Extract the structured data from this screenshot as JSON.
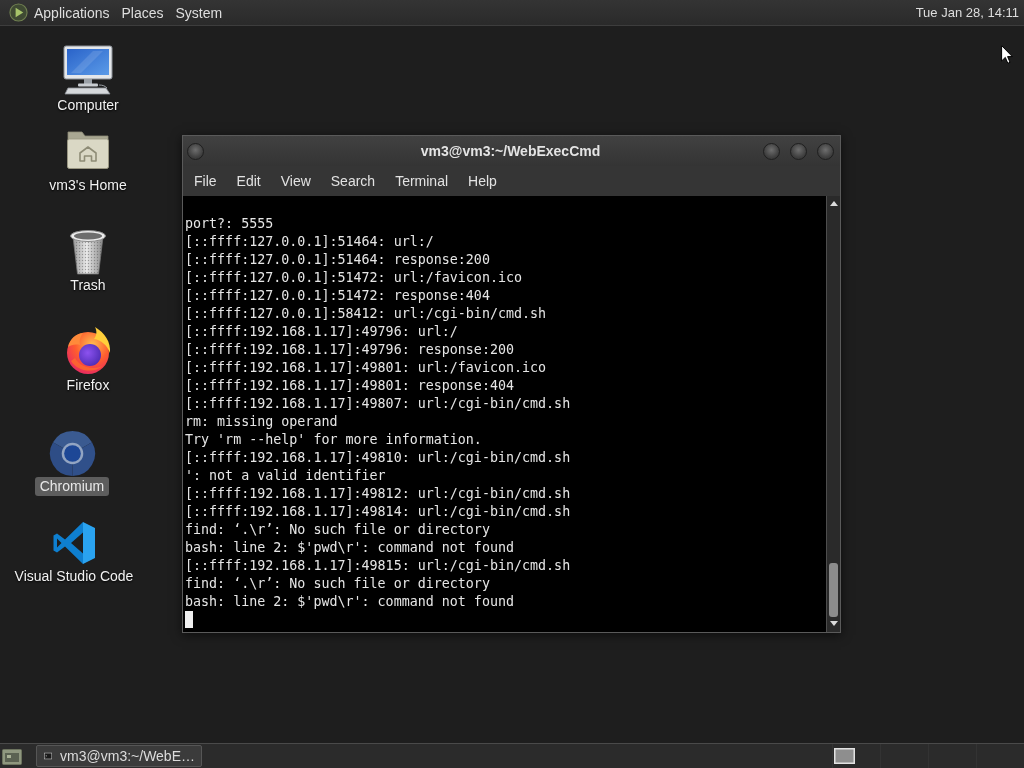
{
  "top_panel": {
    "menus": [
      "Applications",
      "Places",
      "System"
    ],
    "clock": "Tue Jan 28, 14:11"
  },
  "desktop_icons": [
    {
      "label": "Computer",
      "kind": "computer",
      "selected": false
    },
    {
      "label": "vm3's Home",
      "kind": "home",
      "selected": false
    },
    {
      "label": "Trash",
      "kind": "trash",
      "selected": false
    },
    {
      "label": "Firefox",
      "kind": "firefox",
      "selected": false
    },
    {
      "label": "Chromium",
      "kind": "chromium",
      "selected": true
    },
    {
      "label": "Visual Studio Code",
      "kind": "vscode",
      "selected": false
    }
  ],
  "terminal_window": {
    "title": "vm3@vm3:~/WebExecCmd",
    "menu": [
      "File",
      "Edit",
      "View",
      "Search",
      "Terminal",
      "Help"
    ],
    "lines": [
      "port?: 5555",
      "[::ffff:127.0.0.1]:51464: url:/",
      "[::ffff:127.0.0.1]:51464: response:200",
      "[::ffff:127.0.0.1]:51472: url:/favicon.ico",
      "[::ffff:127.0.0.1]:51472: response:404",
      "[::ffff:127.0.0.1]:58412: url:/cgi-bin/cmd.sh",
      "[::ffff:192.168.1.17]:49796: url:/",
      "[::ffff:192.168.1.17]:49796: response:200",
      "[::ffff:192.168.1.17]:49801: url:/favicon.ico",
      "[::ffff:192.168.1.17]:49801: response:404",
      "[::ffff:192.168.1.17]:49807: url:/cgi-bin/cmd.sh",
      "rm: missing operand",
      "Try 'rm --help' for more information.",
      "[::ffff:192.168.1.17]:49810: url:/cgi-bin/cmd.sh",
      "': not a valid identifier",
      "[::ffff:192.168.1.17]:49812: url:/cgi-bin/cmd.sh",
      "[::ffff:192.168.1.17]:49814: url:/cgi-bin/cmd.sh",
      "find: ‘.\\r’: No such file or directory",
      "bash: line 2: $'pwd\\r': command not found",
      "[::ffff:192.168.1.17]:49815: url:/cgi-bin/cmd.sh",
      "find: ‘.\\r’: No such file or directory",
      "bash: line 2: $'pwd\\r': command not found"
    ]
  },
  "taskbar": {
    "tasks": [
      {
        "label": "vm3@vm3:~/WebE…"
      }
    ]
  }
}
